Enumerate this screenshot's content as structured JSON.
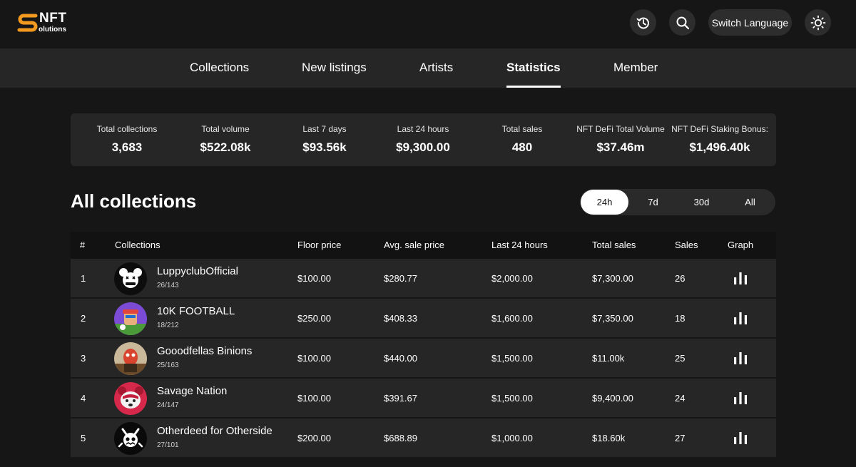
{
  "logo": {
    "brand": "NFT",
    "subtitle": "olutions"
  },
  "header": {
    "history_icon": "history-icon",
    "search_icon": "search-icon",
    "switch_language_label": "Switch Language",
    "theme_icon": "sun-icon"
  },
  "nav": {
    "items": [
      "Collections",
      "New listings",
      "Artists",
      "Statistics",
      "Member"
    ],
    "active": "Statistics"
  },
  "stats": [
    {
      "label": "Total collections",
      "value": "3,683"
    },
    {
      "label": "Total volume",
      "value": "$522.08k"
    },
    {
      "label": "Last 7 days",
      "value": "$93.56k"
    },
    {
      "label": "Last 24 hours",
      "value": "$9,300.00"
    },
    {
      "label": "Total sales",
      "value": "480"
    },
    {
      "label": "NFT DeFi Total Volume",
      "value": "$37.46m"
    },
    {
      "label": "NFT DeFi Staking Bonus:",
      "value": "$1,496.40k"
    }
  ],
  "section": {
    "title": "All collections"
  },
  "filter": {
    "options": [
      "24h",
      "7d",
      "30d",
      "All"
    ],
    "active": "24h"
  },
  "table": {
    "headers": [
      "#",
      "Collections",
      "Floor price",
      "Avg. sale price",
      "Last 24 hours",
      "Total sales",
      "Sales",
      "Graph"
    ],
    "rows": [
      {
        "rank": "1",
        "name": "LuppyclubOfficial",
        "count": "26/143",
        "floor": "$100.00",
        "avg": "$280.77",
        "last24": "$2,000.00",
        "total": "$7,300.00",
        "sales": "26"
      },
      {
        "rank": "2",
        "name": "10K FOOTBALL",
        "count": "18/212",
        "floor": "$250.00",
        "avg": "$408.33",
        "last24": "$1,600.00",
        "total": "$7,350.00",
        "sales": "18"
      },
      {
        "rank": "3",
        "name": "Gooodfellas Binions",
        "count": "25/163",
        "floor": "$100.00",
        "avg": "$440.00",
        "last24": "$1,500.00",
        "total": "$11.00k",
        "sales": "25"
      },
      {
        "rank": "4",
        "name": "Savage Nation",
        "count": "24/147",
        "floor": "$100.00",
        "avg": "$391.67",
        "last24": "$1,500.00",
        "total": "$9,400.00",
        "sales": "24"
      },
      {
        "rank": "5",
        "name": "Otherdeed for Otherside",
        "count": "27/101",
        "floor": "$200.00",
        "avg": "$688.89",
        "last24": "$1,000.00",
        "total": "$18.60k",
        "sales": "27"
      }
    ]
  },
  "colors": {
    "background": "#161616",
    "panel": "#262626",
    "accent": "#f29a1f"
  }
}
